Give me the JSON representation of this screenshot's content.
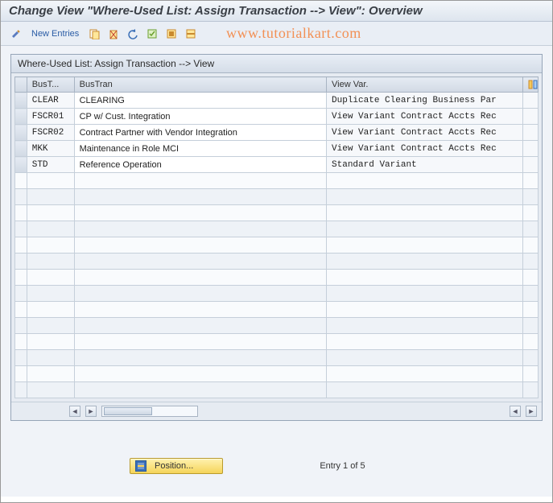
{
  "header": {
    "title": "Change View \"Where-Used List: Assign Transaction --> View\": Overview"
  },
  "toolbar": {
    "new_entries_label": "New Entries"
  },
  "watermark": "www.tutorialkart.com",
  "panel": {
    "title": "Where-Used List: Assign Transaction --> View"
  },
  "columns": {
    "bust": "BusT...",
    "bustran": "BusTran",
    "viewvar": "View Var."
  },
  "rows": [
    {
      "bust": "CLEAR",
      "bustran": "CLEARING",
      "viewvar": "Duplicate Clearing Business Par"
    },
    {
      "bust": "FSCR01",
      "bustran": "CP w/ Cust. Integration",
      "viewvar": "View Variant Contract Accts Rec"
    },
    {
      "bust": "FSCR02",
      "bustran": "Contract Partner with Vendor Integration",
      "viewvar": "View Variant Contract Accts Rec"
    },
    {
      "bust": "MKK",
      "bustran": "Maintenance in Role MCI",
      "viewvar": "View Variant Contract Accts Rec"
    },
    {
      "bust": "STD",
      "bustran": "Reference Operation",
      "viewvar": "Standard Variant"
    }
  ],
  "empty_row_count": 14,
  "footer": {
    "position_label": "Position...",
    "entry_label": "Entry 1 of 5"
  }
}
